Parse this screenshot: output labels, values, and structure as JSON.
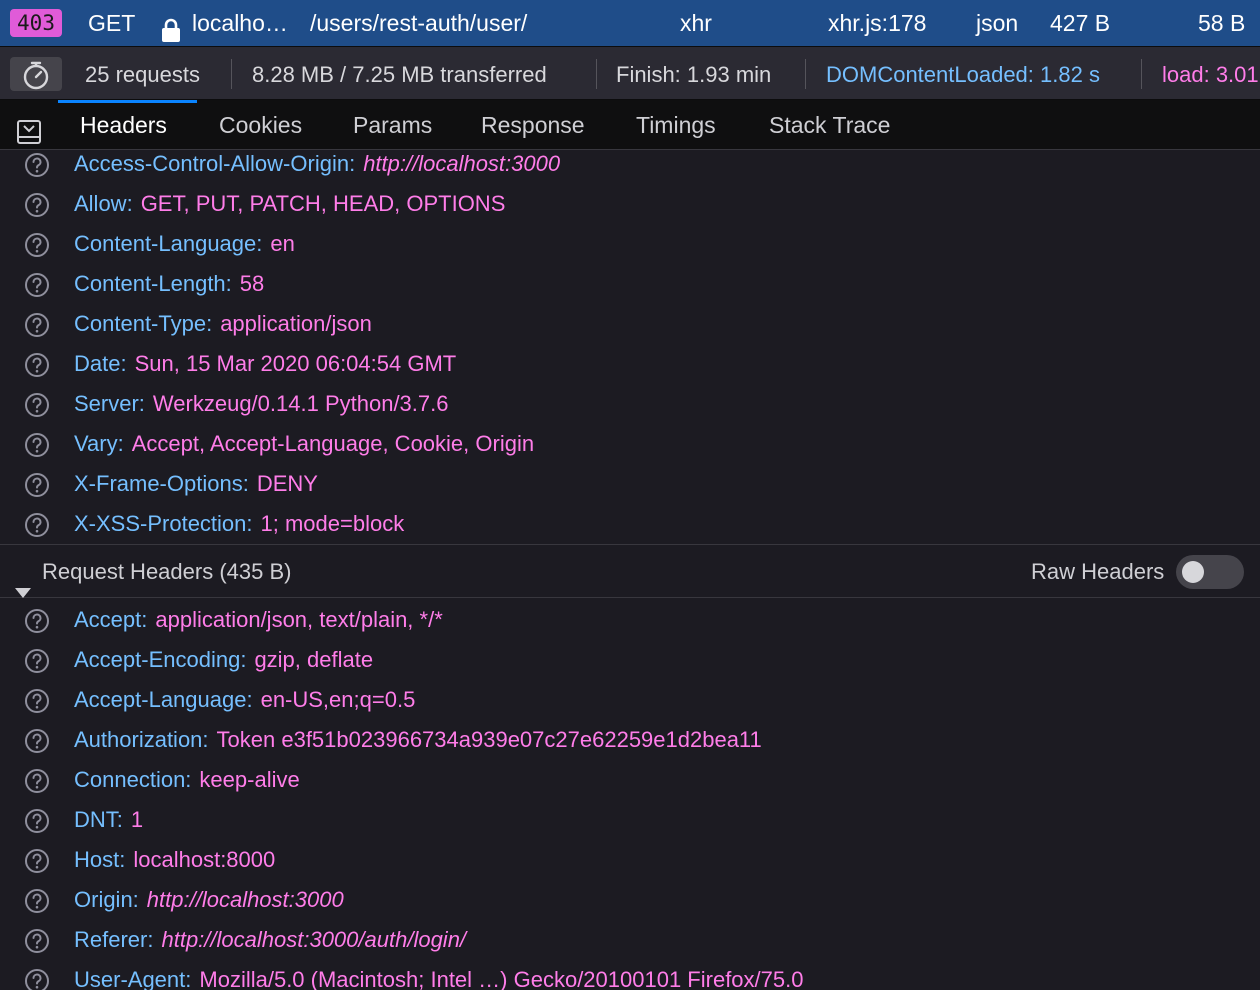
{
  "request_row": {
    "status": "403",
    "method": "GET",
    "domain": "localho…",
    "file": "/users/rest-auth/user/",
    "type": "xhr",
    "initiator": "xhr.js:178",
    "content_type": "json",
    "transferred": "427 B",
    "size": "58 B"
  },
  "summary": {
    "requests": "25 requests",
    "transferred": "8.28 MB / 7.25 MB transferred",
    "finish": "Finish: 1.93 min",
    "dom_content_loaded": "DOMContentLoaded: 1.82 s",
    "load": "load: 3.01"
  },
  "tabs": [
    {
      "label": "Headers",
      "active": true
    },
    {
      "label": "Cookies"
    },
    {
      "label": "Params"
    },
    {
      "label": "Response"
    },
    {
      "label": "Timings"
    },
    {
      "label": "Stack Trace"
    }
  ],
  "response_headers": [
    {
      "name": "Access-Control-Allow-Origin:",
      "value": "http://localhost:3000",
      "url": true
    },
    {
      "name": "Allow:",
      "value": "GET, PUT, PATCH, HEAD, OPTIONS"
    },
    {
      "name": "Content-Language:",
      "value": "en"
    },
    {
      "name": "Content-Length:",
      "value": "58"
    },
    {
      "name": "Content-Type:",
      "value": "application/json"
    },
    {
      "name": "Date:",
      "value": "Sun, 15 Mar 2020 06:04:54 GMT"
    },
    {
      "name": "Server:",
      "value": "Werkzeug/0.14.1 Python/3.7.6"
    },
    {
      "name": "Vary:",
      "value": "Accept, Accept-Language, Cookie, Origin"
    },
    {
      "name": "X-Frame-Options:",
      "value": "DENY"
    },
    {
      "name": "X-XSS-Protection:",
      "value": "1; mode=block"
    }
  ],
  "request_section": {
    "title": "Request Headers (435 B)",
    "raw_headers_label": "Raw Headers",
    "raw_headers_on": false
  },
  "request_headers": [
    {
      "name": "Accept:",
      "value": "application/json, text/plain, */*"
    },
    {
      "name": "Accept-Encoding:",
      "value": "gzip, deflate"
    },
    {
      "name": "Accept-Language:",
      "value": "en-US,en;q=0.5"
    },
    {
      "name": "Authorization:",
      "value": "Token e3f51b023966734a939e07c27e62259e1d2bea11"
    },
    {
      "name": "Connection:",
      "value": "keep-alive"
    },
    {
      "name": "DNT:",
      "value": "1"
    },
    {
      "name": "Host:",
      "value": "localhost:8000"
    },
    {
      "name": "Origin:",
      "value": "http://localhost:3000",
      "url": true
    },
    {
      "name": "Referer:",
      "value": "http://localhost:3000/auth/login/",
      "url": true
    },
    {
      "name": "User-Agent:",
      "value": "Mozilla/5.0 (Macintosh; Intel …) Gecko/20100101 Firefox/75.0"
    }
  ],
  "colors": {
    "selected_row": "#1f4d89",
    "header_name": "#75bfff",
    "header_value": "#ff7de9",
    "status_badge": "#e05bd8",
    "background": "#1c1b22"
  }
}
